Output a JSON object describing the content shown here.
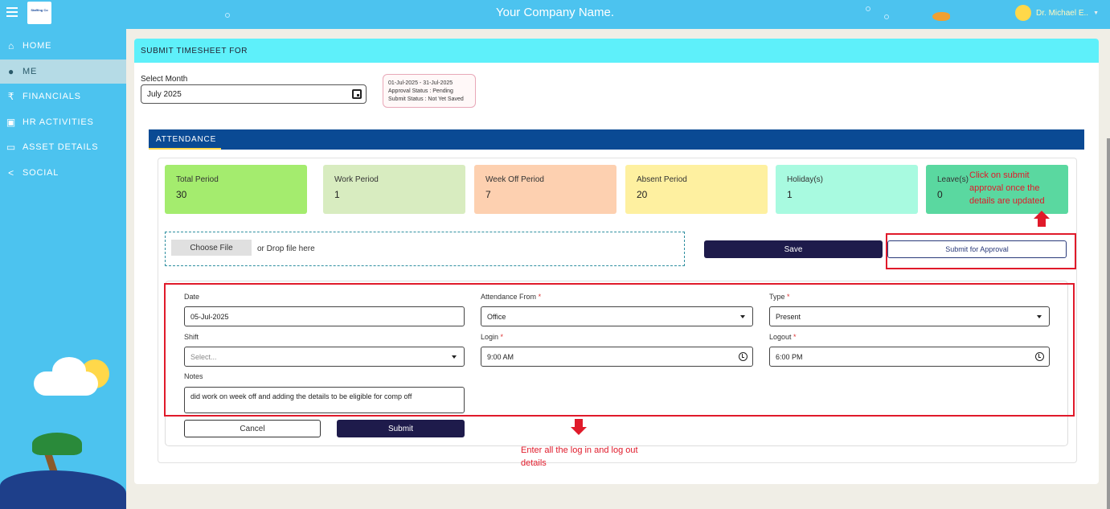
{
  "header": {
    "company_name": "Your Company Name.",
    "user_name": "Dr. Michael E..",
    "logo_text": "Staffing Co"
  },
  "sidebar": {
    "items": [
      {
        "label": "HOME",
        "icon": "home-icon"
      },
      {
        "label": "ME",
        "icon": "person-icon"
      },
      {
        "label": "FINANCIALS",
        "icon": "rupee-icon"
      },
      {
        "label": "HR ACTIVITIES",
        "icon": "badge-icon"
      },
      {
        "label": "ASSET DETAILS",
        "icon": "monitor-icon"
      },
      {
        "label": "SOCIAL",
        "icon": "share-icon"
      }
    ],
    "active_index": 1
  },
  "page": {
    "title": "SUBMIT TIMESHEET FOR",
    "month_label": "Select Month",
    "month_value": "July 2025",
    "status": {
      "period": "01-Jul-2025 - 31-Jul-2025",
      "approval": "Approval Status : Pending",
      "submit": "Submit Status : Not Yet Saved"
    }
  },
  "tabs": {
    "attendance": "ATTENDANCE"
  },
  "summary": {
    "cards": [
      {
        "label": "Total Period",
        "value": "30",
        "color": "#a4ec6e"
      },
      {
        "label": "Work Period",
        "value": "1",
        "color": "#d8ecc0"
      },
      {
        "label": "Week Off Period",
        "value": "7",
        "color": "#fdd0b0"
      },
      {
        "label": "Absent Period",
        "value": "20",
        "color": "#fef0a0"
      },
      {
        "label": "Holiday(s)",
        "value": "1",
        "color": "#a8fae0"
      },
      {
        "label": "Leave(s)",
        "value": "0",
        "color": "#5ad8a0"
      }
    ]
  },
  "upload": {
    "choose_label": "Choose File",
    "drop_text": "or Drop file here"
  },
  "actions": {
    "save_label": "Save",
    "submit_approval_label": "Submit for Approval"
  },
  "form": {
    "date_label": "Date",
    "date_value": "05-Jul-2025",
    "from_label": "Attendance From",
    "from_value": "Office",
    "type_label": "Type",
    "type_value": "Present",
    "shift_label": "Shift",
    "shift_placeholder": "Select...",
    "login_label": "Login",
    "login_value": "9:00 AM",
    "logout_label": "Logout",
    "logout_value": "6:00 PM",
    "notes_label": "Notes",
    "notes_value": "did work on week off and adding the details to be eligible for comp off",
    "required_mark": "*",
    "cancel_label": "Cancel",
    "submit_label": "Submit"
  },
  "annotations": {
    "approval_note": "Click on submit approval once the details are updated",
    "login_note": "Enter all the log in and log out details",
    "color": "#e01a2a"
  }
}
